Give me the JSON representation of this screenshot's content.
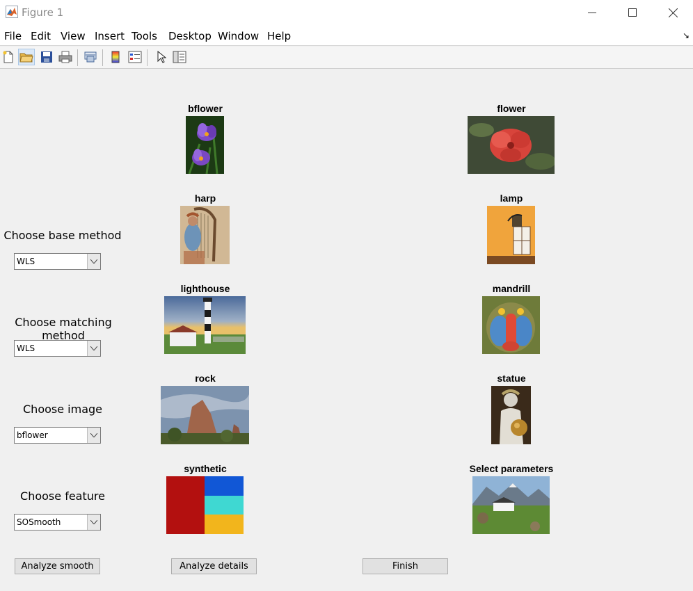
{
  "window": {
    "title": "Figure 1"
  },
  "menu": [
    "File",
    "Edit",
    "View",
    "Insert",
    "Tools",
    "Desktop",
    "Window",
    "Help"
  ],
  "toolbar": [
    "new-figure-icon",
    "open-file-icon",
    "save-icon",
    "print-icon",
    "link-plot-icon",
    "colorbar-icon",
    "legend-icon",
    "pointer-icon",
    "property-inspector-icon"
  ],
  "controls": {
    "base_label": "Choose base method",
    "base_value": "WLS",
    "matching_label": "Choose matching method",
    "matching_value": "WLS",
    "image_label": "Choose image",
    "image_value": "bflower",
    "feature_label": "Choose feature",
    "feature_value": "SOSmooth"
  },
  "buttons": {
    "analyze_smooth": "Analyze smooth",
    "analyze_details": "Analyze details",
    "finish": "Finish"
  },
  "images": {
    "bflower": "bflower",
    "flower": "flower",
    "harp": "harp",
    "lamp": "lamp",
    "lighthouse": "lighthouse",
    "mandrill": "mandrill",
    "rock": "rock",
    "statue": "statue",
    "synthetic": "synthetic",
    "select_parameters": "Select parameters"
  }
}
